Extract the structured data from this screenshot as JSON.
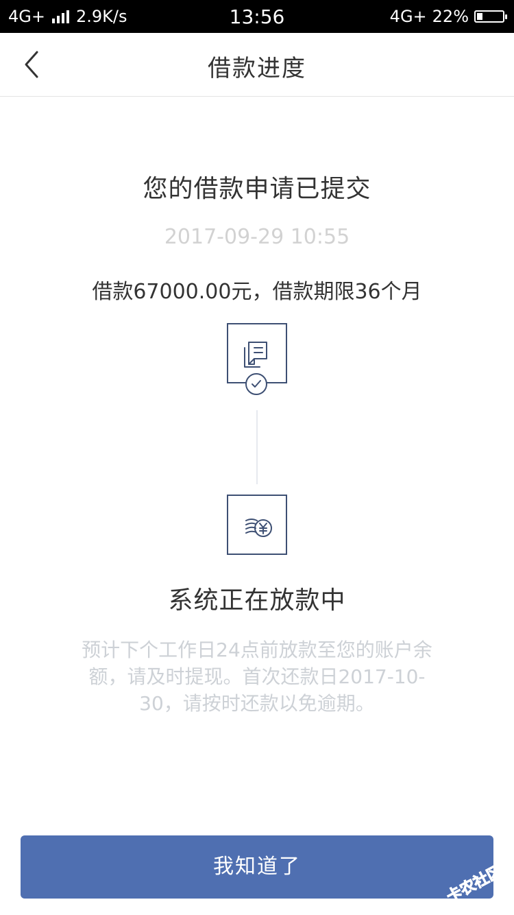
{
  "status_bar": {
    "network": "4G+",
    "speed": "2.9K/s",
    "time": "13:56",
    "network_right": "4G+",
    "battery": "22%",
    "battery_level": 0.22
  },
  "nav": {
    "title": "借款进度"
  },
  "main": {
    "headline": "您的借款申请已提交",
    "timestamp": "2017-09-29 10:55",
    "loan_summary": "借款67000.00元，借款期限36个月",
    "steps": [
      {
        "icon": "document-icon",
        "completed": true
      },
      {
        "icon": "coins-yuan-icon",
        "completed": false
      }
    ],
    "status_title": "系统正在放款中",
    "status_desc": "预计下个工作日24点前放款至您的账户余额，请及时提现。首次还款日2017-10-30，请按时还款以免逾期。"
  },
  "button": {
    "label": "我知道了"
  },
  "watermark": {
    "text": "卡农社区"
  },
  "colors": {
    "accent": "#4f6fb1",
    "icon_stroke": "#3d4f73",
    "muted_text": "#cdd1d6",
    "timestamp": "#d2d2d2"
  }
}
